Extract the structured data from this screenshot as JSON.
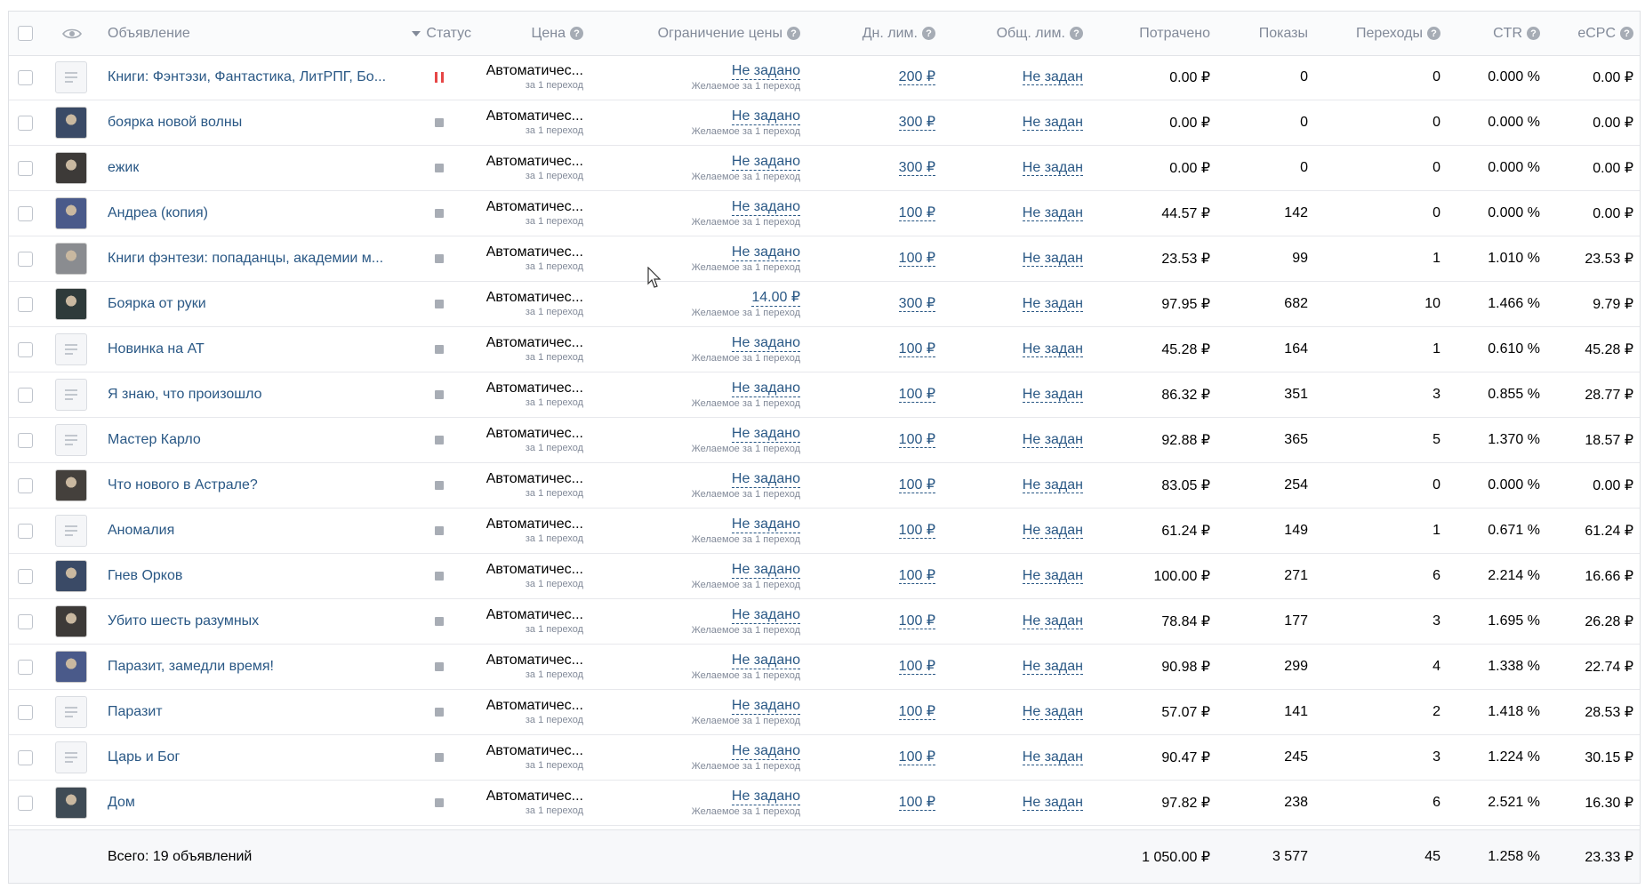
{
  "header": {
    "ad": "Объявление",
    "status": "Статус",
    "price": "Цена",
    "price_limit": "Ограничение цены",
    "daily_limit": "Дн. лим.",
    "total_limit": "Общ. лим.",
    "spent": "Потрачено",
    "impressions": "Показы",
    "clicks": "Переходы",
    "ctr": "CTR",
    "ecpc": "eCPC"
  },
  "rows": [
    {
      "name": "Книги: Фэнтэзи, Фантастика, ЛитРПГ, Бо...",
      "status": "paused",
      "thumb": "placeholder",
      "price": "Автоматичес...",
      "price_sub": "за 1 переход",
      "limit": "Не задано",
      "limit_sub": "Желаемое за 1 переход",
      "daily": "200 ₽",
      "total": "Не задан",
      "spent": "0.00 ₽",
      "impr": "0",
      "clicks": "0",
      "ctr": "0.000 %",
      "ecpc": "0.00 ₽"
    },
    {
      "name": "боярка новой волны",
      "status": "stopped",
      "thumb": "image",
      "price": "Автоматичес...",
      "price_sub": "за 1 переход",
      "limit": "Не задано",
      "limit_sub": "Желаемое за 1 переход",
      "daily": "300 ₽",
      "total": "Не задан",
      "spent": "0.00 ₽",
      "impr": "0",
      "clicks": "0",
      "ctr": "0.000 %",
      "ecpc": "0.00 ₽"
    },
    {
      "name": "ежик",
      "status": "stopped",
      "thumb": "image",
      "price": "Автоматичес...",
      "price_sub": "за 1 переход",
      "limit": "Не задано",
      "limit_sub": "Желаемое за 1 переход",
      "daily": "300 ₽",
      "total": "Не задан",
      "spent": "0.00 ₽",
      "impr": "0",
      "clicks": "0",
      "ctr": "0.000 %",
      "ecpc": "0.00 ₽"
    },
    {
      "name": "Андреа (копия)",
      "status": "stopped",
      "thumb": "image",
      "price": "Автоматичес...",
      "price_sub": "за 1 переход",
      "limit": "Не задано",
      "limit_sub": "Желаемое за 1 переход",
      "daily": "100 ₽",
      "total": "Не задан",
      "spent": "44.57 ₽",
      "impr": "142",
      "clicks": "0",
      "ctr": "0.000 %",
      "ecpc": "0.00 ₽"
    },
    {
      "name": "Книги фэнтези: попаданцы, академии м...",
      "status": "stopped",
      "thumb": "image",
      "price": "Автоматичес...",
      "price_sub": "за 1 переход",
      "limit": "Не задано",
      "limit_sub": "Желаемое за 1 переход",
      "daily": "100 ₽",
      "total": "Не задан",
      "spent": "23.53 ₽",
      "impr": "99",
      "clicks": "1",
      "ctr": "1.010 %",
      "ecpc": "23.53 ₽"
    },
    {
      "name": "Боярка от руки",
      "status": "stopped",
      "thumb": "image",
      "price": "Автоматичес...",
      "price_sub": "за 1 переход",
      "limit": "14.00 ₽",
      "limit_sub": "Желаемое за 1 переход",
      "daily": "300 ₽",
      "total": "Не задан",
      "spent": "97.95 ₽",
      "impr": "682",
      "clicks": "10",
      "ctr": "1.466 %",
      "ecpc": "9.79 ₽"
    },
    {
      "name": "Новинка на АТ",
      "status": "stopped",
      "thumb": "placeholder",
      "price": "Автоматичес...",
      "price_sub": "за 1 переход",
      "limit": "Не задано",
      "limit_sub": "Желаемое за 1 переход",
      "daily": "100 ₽",
      "total": "Не задан",
      "spent": "45.28 ₽",
      "impr": "164",
      "clicks": "1",
      "ctr": "0.610 %",
      "ecpc": "45.28 ₽"
    },
    {
      "name": "Я знаю, что произошло",
      "status": "stopped",
      "thumb": "placeholder",
      "price": "Автоматичес...",
      "price_sub": "за 1 переход",
      "limit": "Не задано",
      "limit_sub": "Желаемое за 1 переход",
      "daily": "100 ₽",
      "total": "Не задан",
      "spent": "86.32 ₽",
      "impr": "351",
      "clicks": "3",
      "ctr": "0.855 %",
      "ecpc": "28.77 ₽"
    },
    {
      "name": "Мастер Карло",
      "status": "stopped",
      "thumb": "placeholder",
      "price": "Автоматичес...",
      "price_sub": "за 1 переход",
      "limit": "Не задано",
      "limit_sub": "Желаемое за 1 переход",
      "daily": "100 ₽",
      "total": "Не задан",
      "spent": "92.88 ₽",
      "impr": "365",
      "clicks": "5",
      "ctr": "1.370 %",
      "ecpc": "18.57 ₽"
    },
    {
      "name": "Что нового в Астрале?",
      "status": "stopped",
      "thumb": "image",
      "price": "Автоматичес...",
      "price_sub": "за 1 переход",
      "limit": "Не задано",
      "limit_sub": "Желаемое за 1 переход",
      "daily": "100 ₽",
      "total": "Не задан",
      "spent": "83.05 ₽",
      "impr": "254",
      "clicks": "0",
      "ctr": "0.000 %",
      "ecpc": "0.00 ₽"
    },
    {
      "name": "Аномалия",
      "status": "stopped",
      "thumb": "placeholder",
      "price": "Автоматичес...",
      "price_sub": "за 1 переход",
      "limit": "Не задано",
      "limit_sub": "Желаемое за 1 переход",
      "daily": "100 ₽",
      "total": "Не задан",
      "spent": "61.24 ₽",
      "impr": "149",
      "clicks": "1",
      "ctr": "0.671 %",
      "ecpc": "61.24 ₽"
    },
    {
      "name": "Гнев Орков",
      "status": "stopped",
      "thumb": "image",
      "price": "Автоматичес...",
      "price_sub": "за 1 переход",
      "limit": "Не задано",
      "limit_sub": "Желаемое за 1 переход",
      "daily": "100 ₽",
      "total": "Не задан",
      "spent": "100.00 ₽",
      "impr": "271",
      "clicks": "6",
      "ctr": "2.214 %",
      "ecpc": "16.66 ₽"
    },
    {
      "name": "Убито шесть разумных",
      "status": "stopped",
      "thumb": "image",
      "price": "Автоматичес...",
      "price_sub": "за 1 переход",
      "limit": "Не задано",
      "limit_sub": "Желаемое за 1 переход",
      "daily": "100 ₽",
      "total": "Не задан",
      "spent": "78.84 ₽",
      "impr": "177",
      "clicks": "3",
      "ctr": "1.695 %",
      "ecpc": "26.28 ₽"
    },
    {
      "name": "Паразит, замедли время!",
      "status": "stopped",
      "thumb": "image",
      "price": "Автоматичес...",
      "price_sub": "за 1 переход",
      "limit": "Не задано",
      "limit_sub": "Желаемое за 1 переход",
      "daily": "100 ₽",
      "total": "Не задан",
      "spent": "90.98 ₽",
      "impr": "299",
      "clicks": "4",
      "ctr": "1.338 %",
      "ecpc": "22.74 ₽"
    },
    {
      "name": "Паразит",
      "status": "stopped",
      "thumb": "placeholder",
      "price": "Автоматичес...",
      "price_sub": "за 1 переход",
      "limit": "Не задано",
      "limit_sub": "Желаемое за 1 переход",
      "daily": "100 ₽",
      "total": "Не задан",
      "spent": "57.07 ₽",
      "impr": "141",
      "clicks": "2",
      "ctr": "1.418 %",
      "ecpc": "28.53 ₽"
    },
    {
      "name": "Царь и Бог",
      "status": "stopped",
      "thumb": "placeholder",
      "price": "Автоматичес...",
      "price_sub": "за 1 переход",
      "limit": "Не задано",
      "limit_sub": "Желаемое за 1 переход",
      "daily": "100 ₽",
      "total": "Не задан",
      "spent": "90.47 ₽",
      "impr": "245",
      "clicks": "3",
      "ctr": "1.224 %",
      "ecpc": "30.15 ₽"
    },
    {
      "name": "Дом",
      "status": "stopped",
      "thumb": "image",
      "price": "Автоматичес...",
      "price_sub": "за 1 переход",
      "limit": "Не задано",
      "limit_sub": "Желаемое за 1 переход",
      "daily": "100 ₽",
      "total": "Не задан",
      "spent": "97.82 ₽",
      "impr": "238",
      "clicks": "6",
      "ctr": "2.521 %",
      "ecpc": "16.30 ₽"
    }
  ],
  "footer": {
    "total_label": "Всего: 19 объявлений",
    "spent": "1 050.00 ₽",
    "impr": "3 577",
    "clicks": "45",
    "ctr": "1.258 %",
    "ecpc": "23.33 ₽"
  },
  "colors": {
    "link": "#2a5885",
    "muted": "#828a99",
    "pause": "#e64646",
    "stop": "#a8adb5"
  },
  "thumb_palette": [
    "#6b5a4a",
    "#3a4a66",
    "#3d3a38",
    "#4a5a8a",
    "#8a8c90",
    "#2e3a3a",
    "#3f4b55",
    "#5a6a80",
    "#34383c",
    "#44403c"
  ]
}
